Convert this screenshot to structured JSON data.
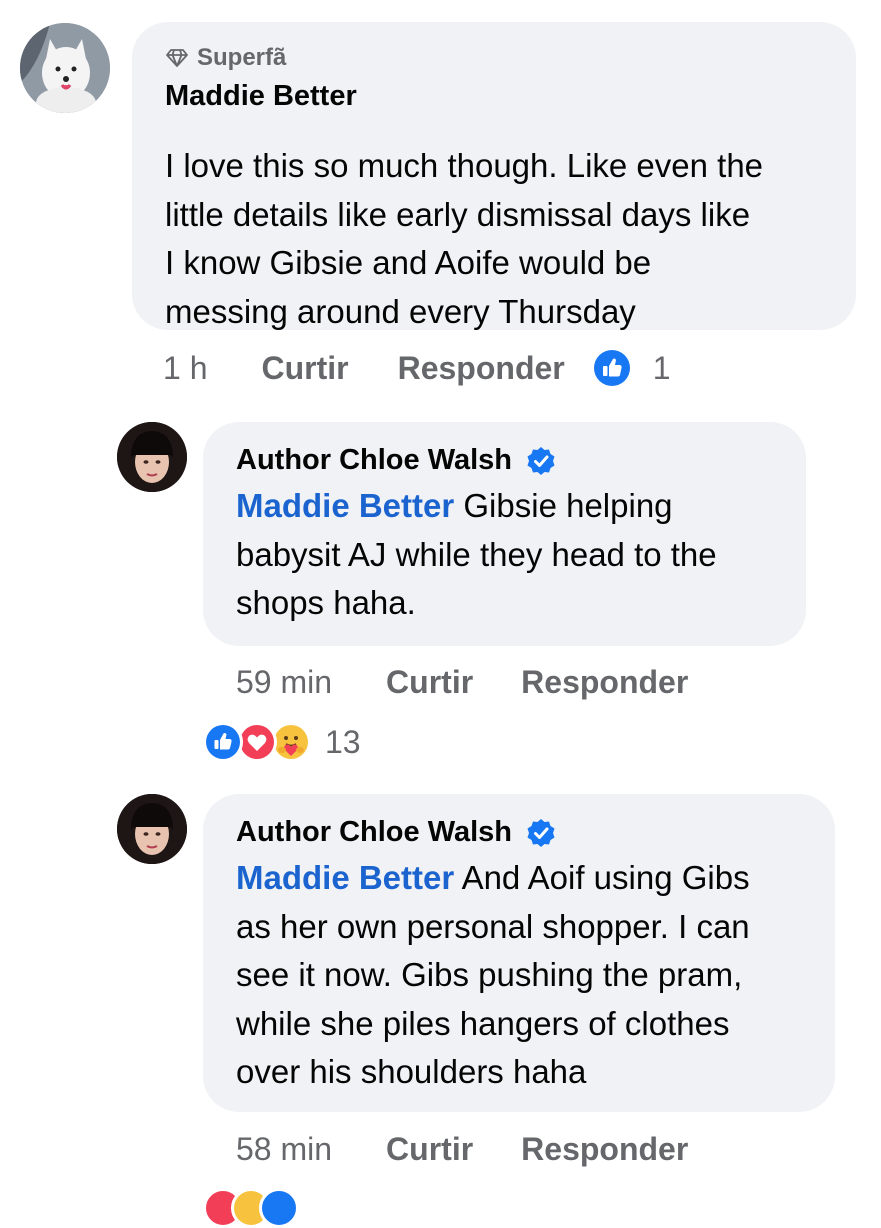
{
  "comments": [
    {
      "badge": "Superfã",
      "author": "Maddie Better",
      "text": "I love this so much though. Like even the\nlittle details like early dismissal days like\nI know Gibsie and Aoife would be\nmessing around every Thursday",
      "time": "1 h",
      "like_label": "Curtir",
      "reply_label": "Responder",
      "reaction_count": "1"
    },
    {
      "author": "Author Chloe Walsh",
      "mention": "Maddie Better",
      "text": " Gibsie helping\nbabysit AJ while they head to the\nshops haha.",
      "time": "59 min",
      "like_label": "Curtir",
      "reply_label": "Responder",
      "reaction_count": "13"
    },
    {
      "author": "Author Chloe Walsh",
      "mention": "Maddie Better",
      "text": " And Aoif using Gibs\nas her own personal shopper. I can\nsee it now. Gibs pushing the pram,\nwhile she piles hangers of clothes\nover his shoulders haha",
      "time": "58 min",
      "like_label": "Curtir",
      "reply_label": "Responder"
    }
  ],
  "colors": {
    "bubble": "#f0f2f5",
    "mention": "#1b64cf",
    "secondary_text": "#65676b",
    "like_blue": "#1877f2",
    "love_red": "#f33e58",
    "verified": "#1877f2"
  },
  "icons": [
    "diamond-icon",
    "verified-badge-icon",
    "like-reaction-icon",
    "love-reaction-icon",
    "care-reaction-icon"
  ]
}
